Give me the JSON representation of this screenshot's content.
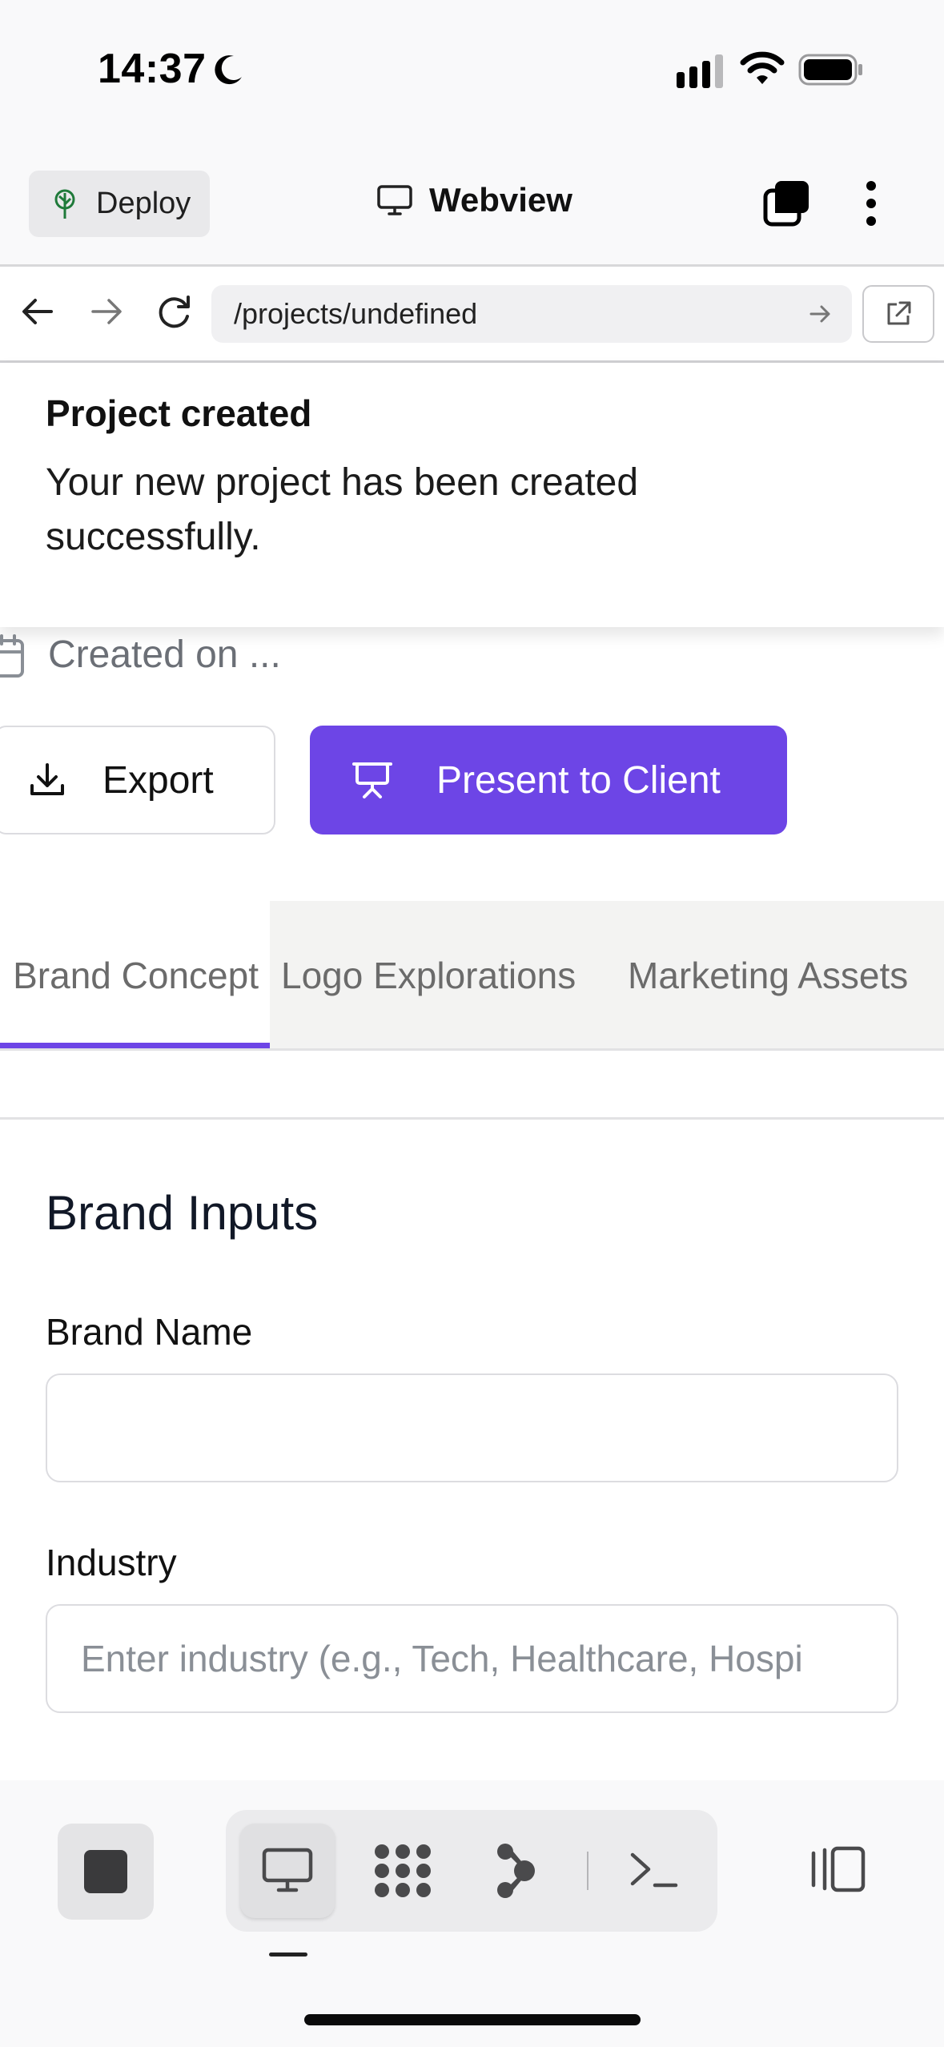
{
  "status_bar": {
    "time": "14:37"
  },
  "header": {
    "deploy_label": "Deploy",
    "title": "Webview"
  },
  "url_bar": {
    "value": "/projects/undefined"
  },
  "toast": {
    "title": "Project created",
    "description": "Your new project has been created successfully."
  },
  "project": {
    "created_text": "Created on ..."
  },
  "actions": {
    "export_label": "Export",
    "present_label": "Present to Client"
  },
  "tabs": [
    {
      "label": "Brand Concept",
      "active": true
    },
    {
      "label": "Logo Explorations",
      "active": false
    },
    {
      "label": "Marketing Assets",
      "active": false
    }
  ],
  "form": {
    "section_title": "Brand Inputs",
    "brand_name_label": "Brand Name",
    "brand_name_value": "",
    "industry_label": "Industry",
    "industry_placeholder": "Enter industry (e.g., Tech, Healthcare, Hospi"
  },
  "toolbar": {
    "items": [
      "desktop-icon",
      "grid-icon",
      "branch-icon",
      "terminal-icon"
    ],
    "active": "desktop-icon"
  },
  "colors": {
    "accent": "#6d45e6",
    "deploy_icon": "#1f7a3a"
  }
}
